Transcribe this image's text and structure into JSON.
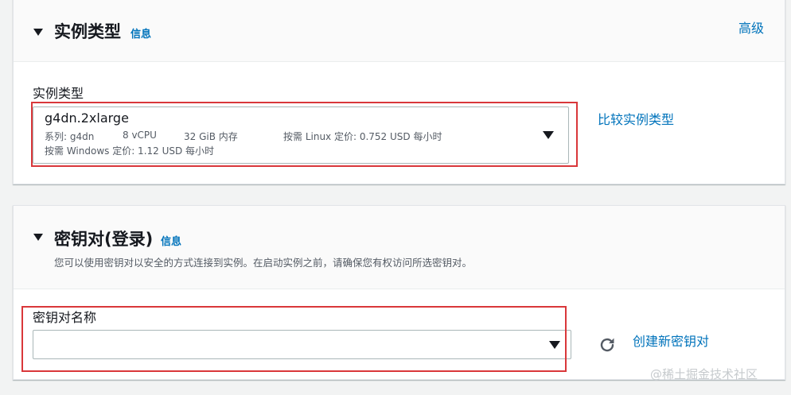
{
  "instance_section": {
    "title": "实例类型",
    "info": "信息",
    "advanced": "高级",
    "field_label": "实例类型",
    "selected": {
      "name": "g4dn.2xlarge",
      "family": "系列: g4dn",
      "vcpu": "8 vCPU",
      "memory": "32 GiB 内存",
      "linux_price": "按需 Linux 定价: 0.752 USD 每小时",
      "windows_price": "按需 Windows 定价: 1.12 USD 每小时"
    },
    "compare_link": "比较实例类型"
  },
  "keypair_section": {
    "title": "密钥对(登录)",
    "info": "信息",
    "description": "您可以使用密钥对以安全的方式连接到实例。在启动实例之前，请确保您有权访问所选密钥对。",
    "field_label": "密钥对名称",
    "selected_value": "",
    "create_link": "创建新密钥对"
  },
  "watermark": "@稀土掘金技术社区",
  "icons": {
    "collapse": "caret-down-icon",
    "dropdown": "dropdown-caret-icon",
    "refresh": "refresh-icon"
  },
  "colors": {
    "link": "#0073bb",
    "highlight_box": "#d9373a"
  }
}
